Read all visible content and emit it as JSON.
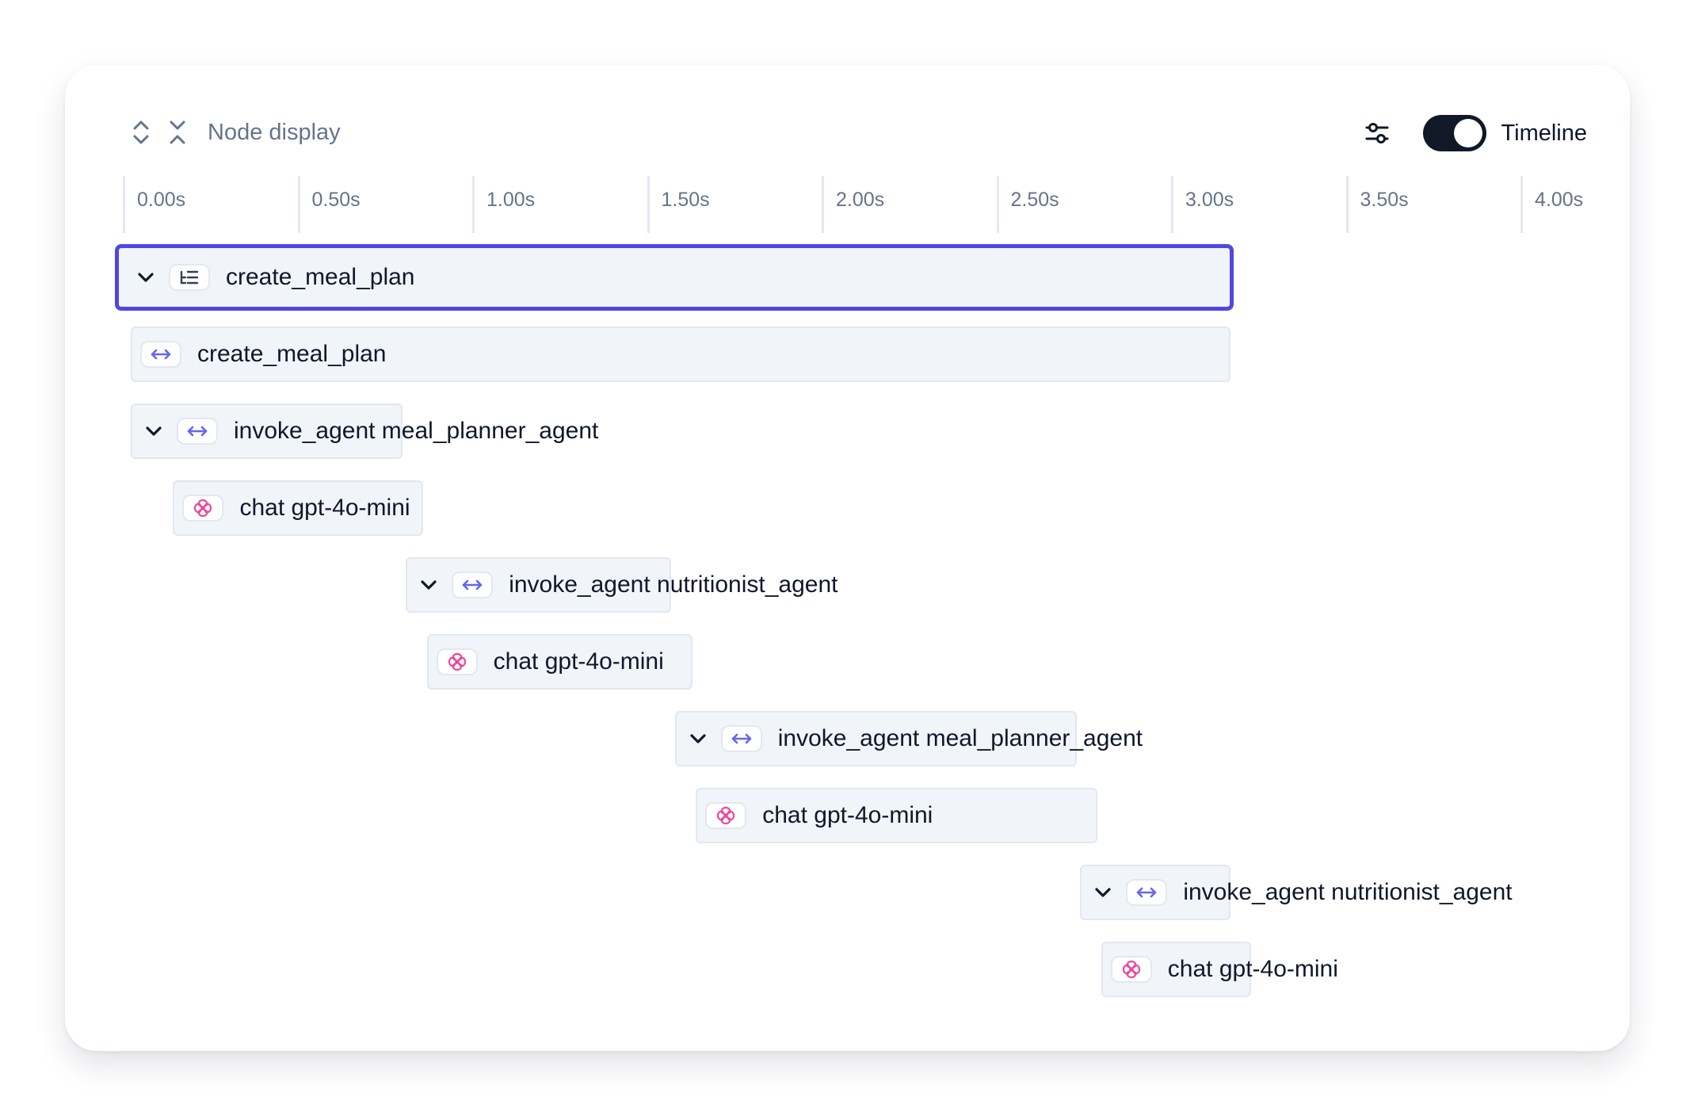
{
  "toolbar": {
    "node_display_label": "Node display",
    "timeline_label": "Timeline",
    "timeline_on": true
  },
  "axis": {
    "ticks": [
      "0.00s",
      "0.50s",
      "1.00s",
      "1.50s",
      "2.00s",
      "2.50s",
      "3.00s",
      "3.50s",
      "4.00s"
    ]
  },
  "colors": {
    "selected_border": "#4f46e5",
    "agent_icon": "#6366f1",
    "llm_icon": "#ec4899",
    "toggle_bg": "#111827"
  },
  "spans": [
    {
      "label": "create_meal_plan",
      "icon": "tree-list-icon",
      "collapsible": true,
      "selected": true,
      "start_s": 0.0,
      "end_s": 3.18
    },
    {
      "label": "create_meal_plan",
      "icon": "arrows-horizontal-icon",
      "collapsible": false,
      "selected": false,
      "start_s": 0.0,
      "end_s": 3.17
    },
    {
      "label": "invoke_agent meal_planner_agent",
      "icon": "arrows-horizontal-icon",
      "collapsible": true,
      "selected": false,
      "start_s": 0.0,
      "end_s": 0.8
    },
    {
      "label": "chat gpt-4o-mini",
      "icon": "openai-icon",
      "collapsible": false,
      "selected": false,
      "start_s": 0.06,
      "end_s": 0.86
    },
    {
      "label": "invoke_agent nutritionist_agent",
      "icon": "arrows-horizontal-icon",
      "collapsible": true,
      "selected": false,
      "start_s": 0.81,
      "end_s": 1.57
    },
    {
      "label": "chat gpt-4o-mini",
      "icon": "openai-icon",
      "collapsible": false,
      "selected": false,
      "start_s": 0.87,
      "end_s": 1.63
    },
    {
      "label": "invoke_agent meal_planner_agent",
      "icon": "arrows-horizontal-icon",
      "collapsible": true,
      "selected": false,
      "start_s": 1.58,
      "end_s": 2.73
    },
    {
      "label": "chat gpt-4o-mini",
      "icon": "openai-icon",
      "collapsible": false,
      "selected": false,
      "start_s": 1.64,
      "end_s": 2.79
    },
    {
      "label": "invoke_agent nutritionist_agent",
      "icon": "arrows-horizontal-icon",
      "collapsible": true,
      "selected": false,
      "start_s": 2.74,
      "end_s": 3.17
    },
    {
      "label": "chat gpt-4o-mini",
      "icon": "openai-icon",
      "collapsible": false,
      "selected": false,
      "start_s": 2.8,
      "end_s": 3.23
    }
  ]
}
